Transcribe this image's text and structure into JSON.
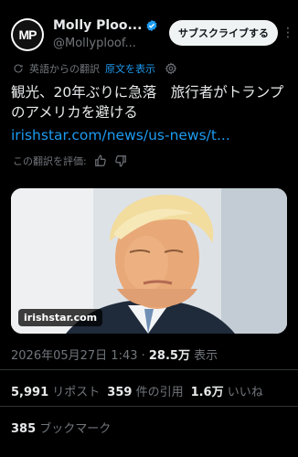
{
  "author": {
    "avatar_initials": "MP",
    "display_name": "Molly Ploo...",
    "handle": "@Mollyploof...",
    "subscribe_label": "サブスクライブする"
  },
  "translation": {
    "source_label": "英語からの翻訳",
    "show_original_label": "原文を表示"
  },
  "tweet": {
    "text": "観光、20年ぶりに急落　旅行者がトランプのアメリカを避ける",
    "link": "irishstar.com/news/us-news/t..."
  },
  "rating": {
    "label": "この翻訳を評価:"
  },
  "media": {
    "source_label": "irishstar.com"
  },
  "meta": {
    "timestamp": "2026年05月27日 1:43 · ",
    "views_value": "28.5万",
    "views_label": " 表示"
  },
  "stats": {
    "reposts_value": "5,991",
    "reposts_label": "リポスト",
    "quotes_value": "359",
    "quotes_label": "件の引用",
    "likes_value": "1.6万",
    "likes_label": "いいね",
    "bookmarks_value": "385",
    "bookmarks_label": "ブックマーク"
  },
  "icons": {
    "verified": "verified-badge-icon",
    "translate": "translate-icon",
    "settings": "gear-icon",
    "thumbs_up": "thumbs-up-icon",
    "thumbs_down": "thumbs-down-icon"
  },
  "colors": {
    "background": "#000000",
    "text": "#e7e9ea",
    "muted": "#71767b",
    "accent": "#1d9bf0",
    "divider": "#2f3336"
  }
}
